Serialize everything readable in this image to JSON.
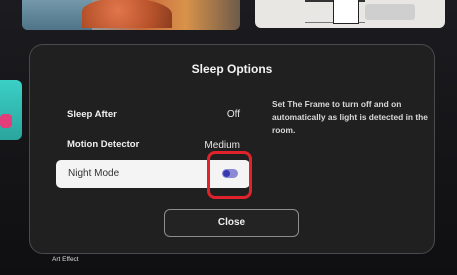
{
  "dialog": {
    "title": "Sleep Options",
    "options": [
      {
        "label": "Sleep After",
        "value": "Off"
      },
      {
        "label": "Motion Detector",
        "value": "Medium"
      }
    ],
    "night_mode": {
      "label": "Night Mode",
      "enabled": true
    },
    "description": "Set The Frame to turn off and on automatically as light is detected in the room.",
    "close_label": "Close"
  },
  "footer": {
    "art_effect_label": "Art Effect"
  },
  "colors": {
    "highlight": "#e0222c",
    "toggle_on": "#3a3ab0",
    "dialog_bg": "#202021"
  }
}
